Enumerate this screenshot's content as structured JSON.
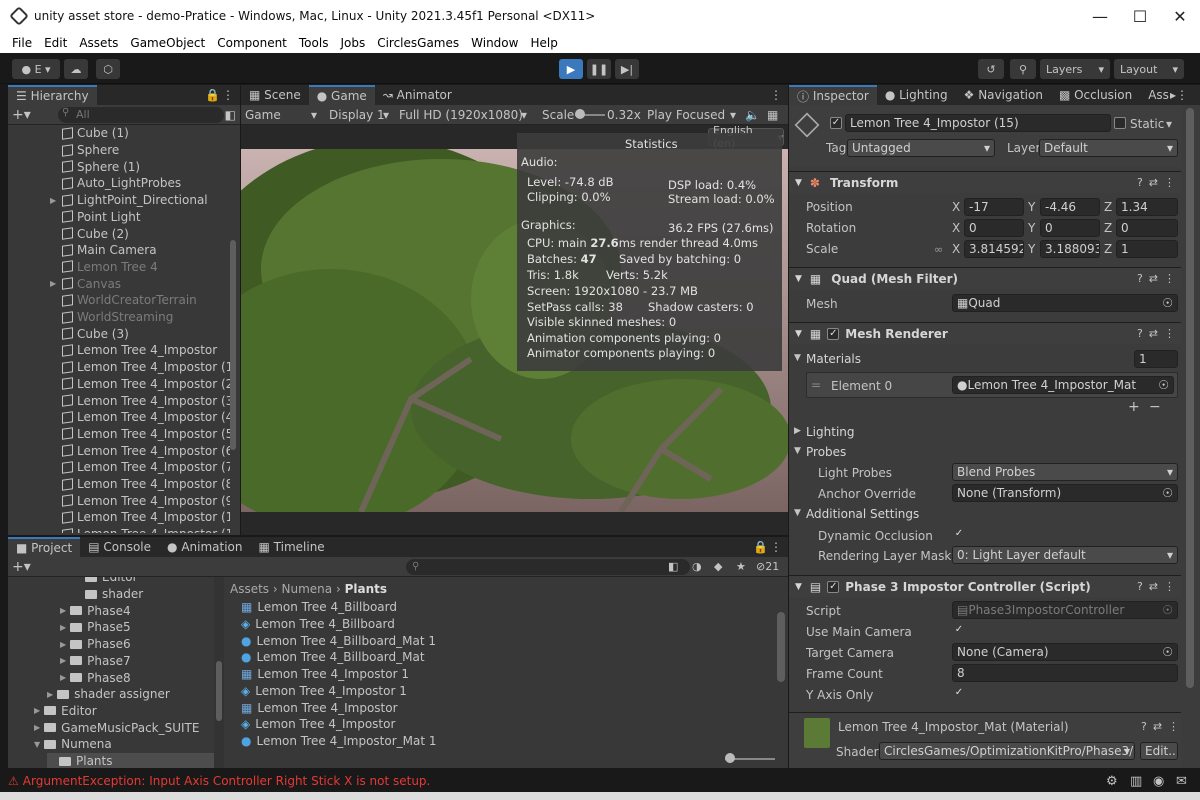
{
  "window": {
    "title": "unity asset store - demo-Pratice - Windows, Mac, Linux - Unity 2021.3.45f1 Personal <DX11>"
  },
  "menu": [
    "File",
    "Edit",
    "Assets",
    "GameObject",
    "Component",
    "Tools",
    "Jobs",
    "CirclesGames",
    "Window",
    "Help"
  ],
  "toolbar": {
    "account": "E",
    "layers": "Layers",
    "layout": "Layout"
  },
  "hierarchy": {
    "tab": "Hierarchy",
    "search_placeholder": "All",
    "items": [
      {
        "label": "Cube (1)",
        "dim": false,
        "fold": false
      },
      {
        "label": "Sphere",
        "dim": false,
        "fold": false
      },
      {
        "label": "Sphere (1)",
        "dim": false,
        "fold": false
      },
      {
        "label": "Auto_LightProbes",
        "dim": false,
        "fold": false
      },
      {
        "label": "LightPoint_Directional",
        "dim": false,
        "fold": true
      },
      {
        "label": "Point Light",
        "dim": false,
        "fold": false
      },
      {
        "label": "Cube (2)",
        "dim": false,
        "fold": false
      },
      {
        "label": "Main Camera",
        "dim": false,
        "fold": false
      },
      {
        "label": "Lemon Tree 4",
        "dim": true,
        "fold": false
      },
      {
        "label": "Canvas",
        "dim": true,
        "fold": true
      },
      {
        "label": "WorldCreatorTerrain",
        "dim": true,
        "fold": false
      },
      {
        "label": "WorldStreaming",
        "dim": true,
        "fold": false
      },
      {
        "label": "Cube (3)",
        "dim": false,
        "fold": false
      },
      {
        "label": "Lemon Tree 4_Impostor",
        "dim": false,
        "fold": false
      },
      {
        "label": "Lemon Tree 4_Impostor (1)",
        "dim": false,
        "fold": false
      },
      {
        "label": "Lemon Tree 4_Impostor (2)",
        "dim": false,
        "fold": false
      },
      {
        "label": "Lemon Tree 4_Impostor (3)",
        "dim": false,
        "fold": false
      },
      {
        "label": "Lemon Tree 4_Impostor (4)",
        "dim": false,
        "fold": false
      },
      {
        "label": "Lemon Tree 4_Impostor (5)",
        "dim": false,
        "fold": false
      },
      {
        "label": "Lemon Tree 4_Impostor (6)",
        "dim": false,
        "fold": false
      },
      {
        "label": "Lemon Tree 4_Impostor (7)",
        "dim": false,
        "fold": false
      },
      {
        "label": "Lemon Tree 4_Impostor (8)",
        "dim": false,
        "fold": false
      },
      {
        "label": "Lemon Tree 4_Impostor (9)",
        "dim": false,
        "fold": false
      },
      {
        "label": "Lemon Tree 4_Impostor (10)",
        "dim": false,
        "fold": false
      },
      {
        "label": "Lemon Tree 4_Impostor (11)",
        "dim": false,
        "fold": false
      }
    ]
  },
  "center_tabs": [
    "Scene",
    "Game",
    "Animator"
  ],
  "game_bar": {
    "mode": "Game",
    "display": "Display 1",
    "resolution": "Full HD (1920x1080)",
    "scale_label": "Scale",
    "scale_value": "0.32x",
    "play_mode": "Play Focused"
  },
  "language": "English (en)",
  "stats": {
    "title": "Statistics",
    "audio_header": "Audio:",
    "level": "Level: -74.8 dB",
    "clipping": "Clipping: 0.0%",
    "dsp": "DSP load: 0.4%",
    "stream": "Stream load: 0.0%",
    "graphics_header": "Graphics:",
    "fps": "36.2 FPS (27.6ms)",
    "cpu_prefix": "CPU: main ",
    "cpu_main": "27.6",
    "cpu_suffix": "ms  render thread 4.0ms",
    "batches_prefix": "Batches: ",
    "batches": "47",
    "saved": "Saved by batching: 0",
    "tris": "Tris: 1.8k",
    "verts": "Verts: 5.2k",
    "screen": "Screen: 1920x1080 - 23.7 MB",
    "setpass": "SetPass calls: 38",
    "shadow": "Shadow casters: 0",
    "skinned": "Visible skinned meshes: 0",
    "anim": "Animation components playing: 0",
    "animator": "Animator components playing: 0"
  },
  "inspector": {
    "tabs": [
      "Inspector",
      "Lighting",
      "Navigation",
      "Occlusion",
      "Ass"
    ],
    "object_name": "Lemon Tree 4_Impostor (15)",
    "static_label": "Static",
    "tag_label": "Tag",
    "tag_value": "Untagged",
    "layer_label": "Layer",
    "layer_value": "Default",
    "transform": {
      "title": "Transform",
      "rows": [
        {
          "label": "Position",
          "x": "-17",
          "y": "-4.46",
          "z": "1.34"
        },
        {
          "label": "Rotation",
          "x": "0",
          "y": "0",
          "z": "0"
        },
        {
          "label": "Scale",
          "x": "3.814592",
          "y": "3.188093",
          "z": "1"
        }
      ]
    },
    "mesh_filter": {
      "title": "Quad (Mesh Filter)",
      "mesh_label": "Mesh",
      "mesh_value": "Quad"
    },
    "mesh_renderer": {
      "title": "Mesh Renderer",
      "materials_label": "Materials",
      "materials_count": "1",
      "element_label": "Element 0",
      "element_value": "Lemon Tree 4_Impostor_Mat",
      "lighting_label": "Lighting",
      "probes_label": "Probes",
      "light_probes_label": "Light Probes",
      "light_probes_value": "Blend Probes",
      "anchor_label": "Anchor Override",
      "anchor_value": "None (Transform)",
      "additional_label": "Additional Settings",
      "dynamic_occlusion_label": "Dynamic Occlusion",
      "rendering_layer_label": "Rendering Layer Mask",
      "rendering_layer_value": "0: Light Layer default"
    },
    "script_component": {
      "title": "Phase 3 Impostor Controller (Script)",
      "script_label": "Script",
      "script_value": "Phase3ImpostorController",
      "use_main_label": "Use Main Camera",
      "target_label": "Target Camera",
      "target_value": "None (Camera)",
      "frame_label": "Frame Count",
      "frame_value": "8",
      "yaxis_label": "Y Axis Only"
    },
    "material": {
      "title": "Lemon Tree 4_Impostor_Mat (Material)",
      "shader_label": "Shader",
      "shader_value": "CirclesGames/OptimizationKitPro/Phase3/Impos",
      "edit_label": "Edit..."
    }
  },
  "project": {
    "tabs": [
      "Project",
      "Console",
      "Animation",
      "Timeline"
    ],
    "hidden_count": "21",
    "tree": [
      {
        "label": "Editor",
        "indent": 3,
        "fold": false
      },
      {
        "label": "shader",
        "indent": 3,
        "fold": false
      },
      {
        "label": "Phase4",
        "indent": 2,
        "fold": true
      },
      {
        "label": "Phase5",
        "indent": 2,
        "fold": true
      },
      {
        "label": "Phase6",
        "indent": 2,
        "fold": true
      },
      {
        "label": "Phase7",
        "indent": 2,
        "fold": true
      },
      {
        "label": "Phase8",
        "indent": 2,
        "fold": true
      },
      {
        "label": "shader assigner",
        "indent": 1,
        "fold": true
      },
      {
        "label": "Editor",
        "indent": 0,
        "fold": true
      },
      {
        "label": "GameMusicPack_SUITE",
        "indent": 0,
        "fold": true
      },
      {
        "label": "Numena",
        "indent": 0,
        "fold": true
      },
      {
        "label": "Plants",
        "indent": 1,
        "fold": false
      }
    ],
    "breadcrumb": [
      "Assets",
      "Numena",
      "Plants"
    ],
    "assets": [
      {
        "label": "Lemon Tree 4_Billboard",
        "kind": "mesh"
      },
      {
        "label": "Lemon Tree 4_Billboard",
        "kind": "prefab"
      },
      {
        "label": "Lemon Tree 4_Billboard_Mat 1",
        "kind": "material"
      },
      {
        "label": "Lemon Tree 4_Billboard_Mat",
        "kind": "material"
      },
      {
        "label": "Lemon Tree 4_Impostor 1",
        "kind": "mesh"
      },
      {
        "label": "Lemon Tree 4_Impostor 1",
        "kind": "prefab"
      },
      {
        "label": "Lemon Tree 4_Impostor",
        "kind": "mesh"
      },
      {
        "label": "Lemon Tree 4_Impostor",
        "kind": "prefab"
      },
      {
        "label": "Lemon Tree 4_Impostor_Mat 1",
        "kind": "material"
      }
    ]
  },
  "statusbar": {
    "error": "ArgumentException: Input Axis Controller Right Stick X is not setup."
  },
  "colors": {
    "accent": "#3a79bb",
    "error": "#e53935",
    "panel": "#383838"
  }
}
